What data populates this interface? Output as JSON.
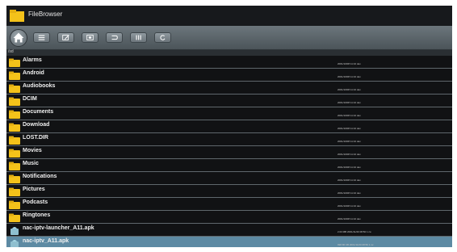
{
  "app": {
    "title": "FileBrowser"
  },
  "toolbar": {
    "buttons": [
      {
        "name": "home-button",
        "icon": "home-icon"
      },
      {
        "name": "list-view-button",
        "icon": "list-icon"
      },
      {
        "name": "edit-button",
        "icon": "edit-icon"
      },
      {
        "name": "multi-select-button",
        "icon": "select-icon"
      },
      {
        "name": "back-button",
        "icon": "undo-icon"
      },
      {
        "name": "columns-button",
        "icon": "columns-icon"
      },
      {
        "name": "refresh-button",
        "icon": "refresh-icon"
      }
    ]
  },
  "path": {
    "label": "/sd"
  },
  "files": [
    {
      "name": "Alarms",
      "type": "folder",
      "date": "2001/10/08 11:10 dev"
    },
    {
      "name": "Android",
      "type": "folder",
      "date": "2001/10/08 11:10 dev"
    },
    {
      "name": "Audiobooks",
      "type": "folder",
      "date": "2001/10/08 11:10 dev"
    },
    {
      "name": "DCIM",
      "type": "folder",
      "date": "2001/10/08 11:10 dev"
    },
    {
      "name": "Documents",
      "type": "folder",
      "date": "2001/10/08 11:10 dev"
    },
    {
      "name": "Download",
      "type": "folder",
      "date": "2001/10/08 11:10 dev"
    },
    {
      "name": "LOST.DIR",
      "type": "folder",
      "date": "2001/10/08 11:10 dev"
    },
    {
      "name": "Movies",
      "type": "folder",
      "date": "2001/10/08 11:10 dev"
    },
    {
      "name": "Music",
      "type": "folder",
      "date": "2001/10/08 11:10 dev"
    },
    {
      "name": "Notifications",
      "type": "folder",
      "date": "2001/10/08 11:10 dev"
    },
    {
      "name": "Pictures",
      "type": "folder",
      "date": "2001/10/08 11:10 dev"
    },
    {
      "name": "Podcasts",
      "type": "folder",
      "date": "2001/10/08 11:10 dev"
    },
    {
      "name": "Ringtones",
      "type": "folder",
      "date": "2001/10/08 11:10 dev"
    },
    {
      "name": "nac-iptv-launcher_A11.apk",
      "type": "apk",
      "date": "2.03 MB 2001/11/20 08:50 1 rw"
    },
    {
      "name": "nac-iptv_A11.apk",
      "type": "apk",
      "date": "998.86 KB 2001/11/20 08:50 1 rw",
      "selected": true
    }
  ],
  "colors": {
    "folder": "#f4c21a",
    "apk": "#8fbfcf",
    "selected": "#5d8aa3"
  }
}
